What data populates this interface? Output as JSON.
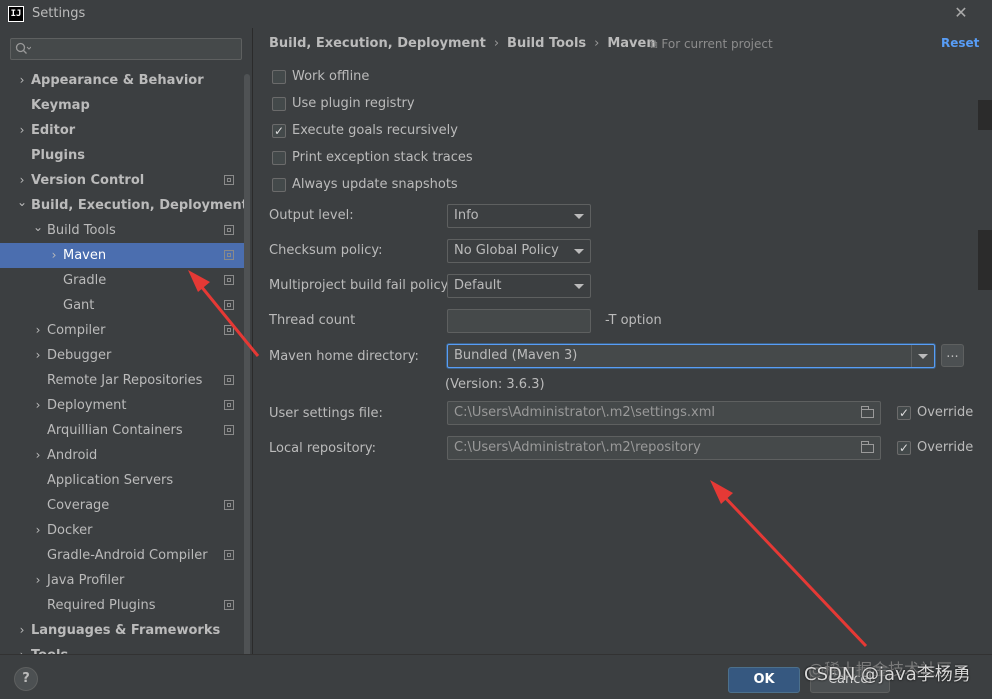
{
  "window": {
    "title": "Settings",
    "app_icon_text": "IJ"
  },
  "search": {
    "placeholder": ""
  },
  "tree": [
    {
      "label": "Appearance & Behavior",
      "bold": true,
      "chevron": "right",
      "indent": 0,
      "project": false
    },
    {
      "label": "Keymap",
      "bold": true,
      "chevron": "",
      "indent": 0,
      "project": false
    },
    {
      "label": "Editor",
      "bold": true,
      "chevron": "right",
      "indent": 0,
      "project": false
    },
    {
      "label": "Plugins",
      "bold": true,
      "chevron": "",
      "indent": 0,
      "project": false
    },
    {
      "label": "Version Control",
      "bold": true,
      "chevron": "right",
      "indent": 0,
      "project": true
    },
    {
      "label": "Build, Execution, Deployment",
      "bold": true,
      "chevron": "down",
      "indent": 0,
      "project": false
    },
    {
      "label": "Build Tools",
      "bold": false,
      "chevron": "down",
      "indent": 1,
      "project": true
    },
    {
      "label": "Maven",
      "bold": false,
      "chevron": "right",
      "indent": 2,
      "project": true,
      "selected": true
    },
    {
      "label": "Gradle",
      "bold": false,
      "chevron": "",
      "indent": 2,
      "project": true
    },
    {
      "label": "Gant",
      "bold": false,
      "chevron": "",
      "indent": 2,
      "project": true
    },
    {
      "label": "Compiler",
      "bold": false,
      "chevron": "right",
      "indent": 1,
      "project": true
    },
    {
      "label": "Debugger",
      "bold": false,
      "chevron": "right",
      "indent": 1,
      "project": false
    },
    {
      "label": "Remote Jar Repositories",
      "bold": false,
      "chevron": "",
      "indent": 1,
      "project": true
    },
    {
      "label": "Deployment",
      "bold": false,
      "chevron": "right",
      "indent": 1,
      "project": true
    },
    {
      "label": "Arquillian Containers",
      "bold": false,
      "chevron": "",
      "indent": 1,
      "project": true
    },
    {
      "label": "Android",
      "bold": false,
      "chevron": "right",
      "indent": 1,
      "project": false
    },
    {
      "label": "Application Servers",
      "bold": false,
      "chevron": "",
      "indent": 1,
      "project": false
    },
    {
      "label": "Coverage",
      "bold": false,
      "chevron": "",
      "indent": 1,
      "project": true
    },
    {
      "label": "Docker",
      "bold": false,
      "chevron": "right",
      "indent": 1,
      "project": false
    },
    {
      "label": "Gradle-Android Compiler",
      "bold": false,
      "chevron": "",
      "indent": 1,
      "project": true
    },
    {
      "label": "Java Profiler",
      "bold": false,
      "chevron": "right",
      "indent": 1,
      "project": false
    },
    {
      "label": "Required Plugins",
      "bold": false,
      "chevron": "",
      "indent": 1,
      "project": true
    },
    {
      "label": "Languages & Frameworks",
      "bold": true,
      "chevron": "right",
      "indent": 0,
      "project": false
    },
    {
      "label": "Tools",
      "bold": true,
      "chevron": "right",
      "indent": 0,
      "project": false
    }
  ],
  "breadcrumb": {
    "part1": "Build, Execution, Deployment",
    "part2": "Build Tools",
    "part3": "Maven",
    "sep": "›"
  },
  "for_project": "⧉ For current project",
  "reset": "Reset",
  "checkboxes": [
    {
      "label": "Work offline",
      "checked": false
    },
    {
      "label": "Use plugin registry",
      "checked": false
    },
    {
      "label": "Execute goals recursively",
      "checked": true
    },
    {
      "label": "Print exception stack traces",
      "checked": false
    },
    {
      "label": "Always update snapshots",
      "checked": false
    }
  ],
  "form": {
    "output_level_label": "Output level:",
    "output_level_value": "Info",
    "checksum_label": "Checksum policy:",
    "checksum_value": "No Global Policy",
    "fail_policy_label": "Multiproject build fail policy:",
    "fail_policy_value": "Default",
    "thread_count_label": "Thread count",
    "thread_count_value": "",
    "thread_hint": "-T option",
    "maven_home_label": "Maven home directory:",
    "maven_home_value": "Bundled (Maven 3)",
    "maven_home_browse": "...",
    "version_text": "(Version: 3.6.3)",
    "user_settings_label": "User settings file:",
    "user_settings_value": "C:\\Users\\Administrator\\.m2\\settings.xml",
    "local_repo_label": "Local repository:",
    "local_repo_value": "C:\\Users\\Administrator\\.m2\\repository",
    "override_label": "Override"
  },
  "footer": {
    "help": "?",
    "ok": "OK",
    "cancel": "Cancel",
    "watermark": "CSDN @java李杨勇",
    "watermark_bg": "@稀土掘金技术社区"
  },
  "colors": {
    "background": "#3c3f41",
    "selection": "#4b6eaf",
    "accent_link": "#589df6",
    "arrow": "#e53935"
  }
}
